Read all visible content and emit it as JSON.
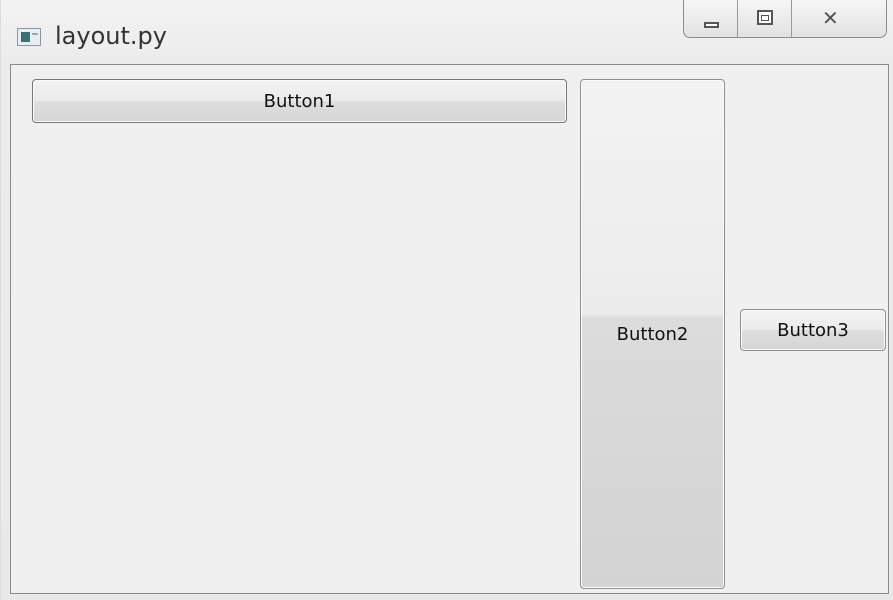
{
  "window": {
    "title": "layout.py",
    "icon": "python-app-icon",
    "controls": {
      "minimize_icon": "minimize-icon",
      "maximize_icon": "restore-icon",
      "close_icon": "close-icon",
      "close_glyph": "✕"
    }
  },
  "client": {
    "buttons": [
      {
        "label": "Button1"
      },
      {
        "label": "Button2"
      },
      {
        "label": "Button3"
      }
    ]
  }
}
